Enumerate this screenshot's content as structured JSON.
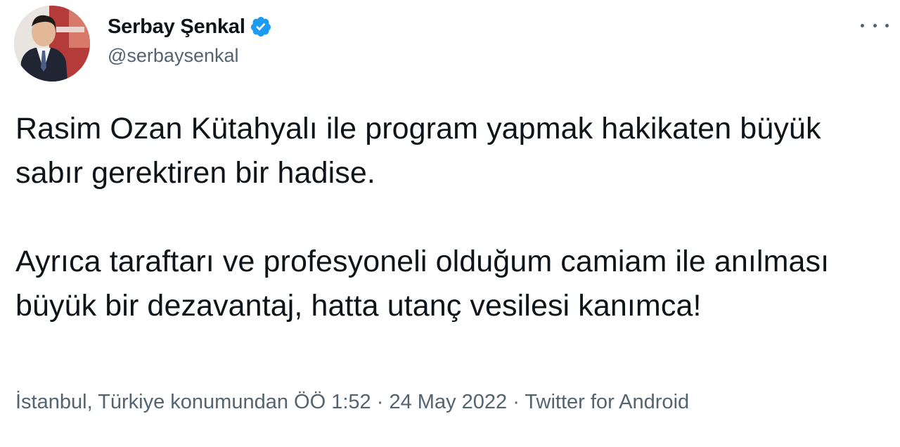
{
  "tweet": {
    "author": {
      "display_name": "Serbay Şenkal",
      "handle": "@serbaysenkal",
      "verified_icon": "verified-badge-icon",
      "avatar": "avatar-photo"
    },
    "more_icon": "more-options-icon",
    "text": {
      "paragraph_1": "Rasim Ozan Kütahyalı ile program yapmak hakikaten büyük sabır gerektiren bir hadise.",
      "paragraph_2": "Ayrıca taraftarı ve profesyoneli olduğum camiam ile anılması büyük bir dezavantaj, hatta utanç vesilesi kanımca!"
    },
    "meta": {
      "location": "İstanbul, Türkiye konumundan",
      "time": "ÖÖ 1:52",
      "separator": "·",
      "date": "24 May 2022",
      "source": "Twitter for Android"
    },
    "colors": {
      "text": "#0f1419",
      "secondary": "#536471",
      "verified": "#1d9bf0"
    }
  }
}
